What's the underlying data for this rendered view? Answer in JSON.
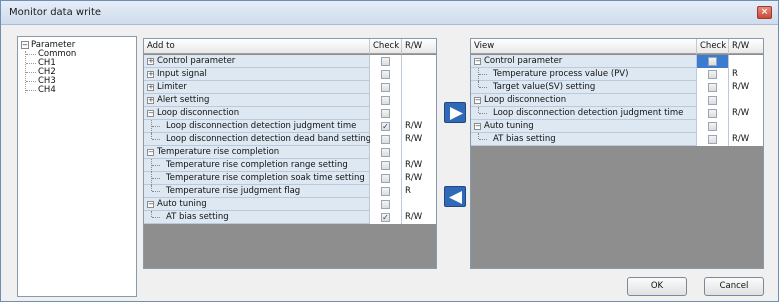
{
  "window": {
    "title": "Monitor data write",
    "close_glyph": "×"
  },
  "tree": {
    "root": "Parameter",
    "children": [
      "Common",
      "CH1",
      "CH2",
      "CH3",
      "CH4"
    ]
  },
  "add_to": {
    "headers": {
      "name": "Add to",
      "check": "Check",
      "rw": "R/W"
    },
    "rows": [
      {
        "label": "Control parameter",
        "rw": ""
      },
      {
        "label": "Input signal",
        "rw": ""
      },
      {
        "label": "Limiter",
        "rw": ""
      },
      {
        "label": "Alert setting",
        "rw": ""
      },
      {
        "label": "Loop disconnection",
        "rw": ""
      },
      {
        "label": "Loop disconnection detection judgment time",
        "rw": "R/W"
      },
      {
        "label": "Loop disconnection detection dead band setting",
        "rw": "R/W"
      },
      {
        "label": "Temperature rise completion",
        "rw": ""
      },
      {
        "label": "Temperature rise completion range setting",
        "rw": "R/W"
      },
      {
        "label": "Temperature rise completion soak time setting",
        "rw": "R/W"
      },
      {
        "label": "Temperature rise judgment flag",
        "rw": "R"
      },
      {
        "label": "Auto tuning",
        "rw": ""
      },
      {
        "label": "AT bias setting",
        "rw": "R/W"
      }
    ]
  },
  "view": {
    "headers": {
      "name": "View",
      "check": "Check",
      "rw": "R/W"
    },
    "rows": [
      {
        "label": "Control parameter",
        "rw": ""
      },
      {
        "label": "Temperature process value (PV)",
        "rw": "R"
      },
      {
        "label": "Target value(SV) setting",
        "rw": "R/W"
      },
      {
        "label": "Loop disconnection",
        "rw": ""
      },
      {
        "label": "Loop disconnection detection judgment time",
        "rw": "R/W"
      },
      {
        "label": "Auto tuning",
        "rw": ""
      },
      {
        "label": "AT bias setting",
        "rw": "R/W"
      }
    ]
  },
  "glyphs": {
    "expand": "+",
    "collapse": "−",
    "check": "✓"
  },
  "buttons": {
    "ok": "OK",
    "cancel": "Cancel"
  },
  "colors": {
    "row_bg": "#dde8f3",
    "arrow_button": "#2f69b8",
    "panel_empty": "#8e8e8e"
  }
}
